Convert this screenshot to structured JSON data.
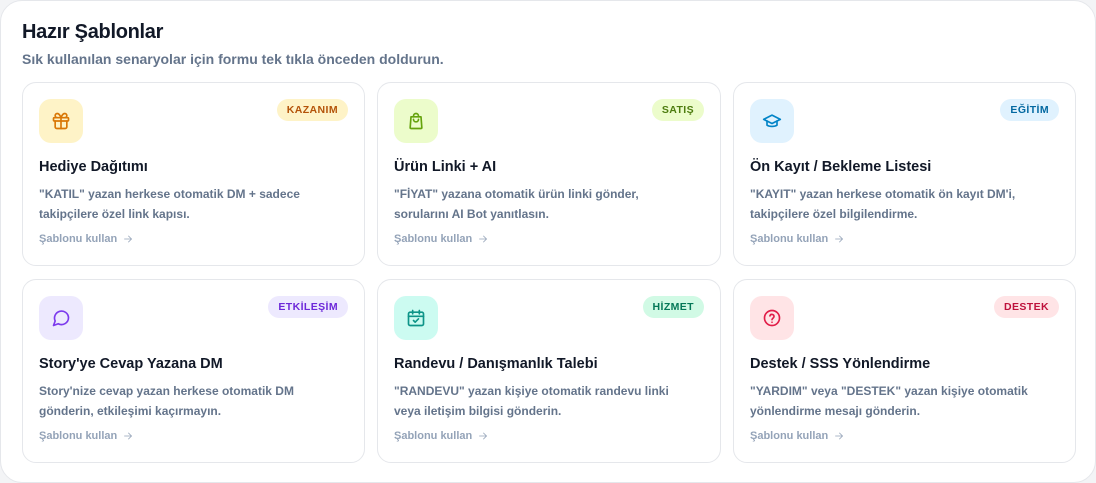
{
  "header": {
    "title": "Hazır Şablonlar",
    "subtitle": "Sık kullanılan senaryolar için formu tek tıkla önceden doldurun."
  },
  "templates": [
    {
      "badge": "KAZANIM",
      "title": "Hediye Dağıtımı",
      "description": "\"KATIL\" yazan herkese otomatik DM + sadece takipçilere özel link kapısı.",
      "link": "Şablonu kullan",
      "icon": "gift-icon",
      "colors": {
        "icon_bg": "#fef3c7",
        "icon": "#d97706",
        "badge_bg": "#fef3c7",
        "badge_text": "#b45309"
      }
    },
    {
      "badge": "SATIŞ",
      "title": "Ürün Linki + AI",
      "description": "\"FİYAT\" yazana otomatik ürün linki gönder, sorularını AI Bot yanıtlasın.",
      "link": "Şablonu kullan",
      "icon": "shopping-bag-icon",
      "colors": {
        "icon_bg": "#ecfccb",
        "icon": "#65a30d",
        "badge_bg": "#ecfccb",
        "badge_text": "#4d7c0f"
      }
    },
    {
      "badge": "EĞİTİM",
      "title": "Ön Kayıt / Bekleme Listesi",
      "description": "\"KAYIT\" yazan herkese otomatik ön kayıt DM'i, takipçilere özel bilgilendirme.",
      "link": "Şablonu kullan",
      "icon": "graduation-cap-icon",
      "colors": {
        "icon_bg": "#e0f2fe",
        "icon": "#0284c7",
        "badge_bg": "#e0f2fe",
        "badge_text": "#0369a1"
      }
    },
    {
      "badge": "ETKİLEŞİM",
      "title": "Story'ye Cevap Yazana DM",
      "description": "Story'nize cevap yazan herkese otomatik DM gönderin, etkileşimi kaçırmayın.",
      "link": "Şablonu kullan",
      "icon": "message-circle-icon",
      "colors": {
        "icon_bg": "#ede9fe",
        "icon": "#7c3aed",
        "badge_bg": "#ede9fe",
        "badge_text": "#6d28d9"
      }
    },
    {
      "badge": "HİZMET",
      "title": "Randevu / Danışmanlık Talebi",
      "description": "\"RANDEVU\" yazan kişiye otomatik randevu linki veya iletişim bilgisi gönderin.",
      "link": "Şablonu kullan",
      "icon": "calendar-check-icon",
      "colors": {
        "icon_bg": "#ccfbf1",
        "icon": "#0d9488",
        "badge_bg": "#d1fae5",
        "badge_text": "#047857"
      }
    },
    {
      "badge": "DESTEK",
      "title": "Destek / SSS Yönlendirme",
      "description": "\"YARDIM\" veya \"DESTEK\" yazan kişiye otomatik yönlendirme mesajı gönderin.",
      "link": "Şablonu kullan",
      "icon": "help-circle-icon",
      "colors": {
        "icon_bg": "#ffe4e6",
        "icon": "#e11d48",
        "badge_bg": "#ffe4e6",
        "badge_text": "#be123c"
      }
    }
  ]
}
